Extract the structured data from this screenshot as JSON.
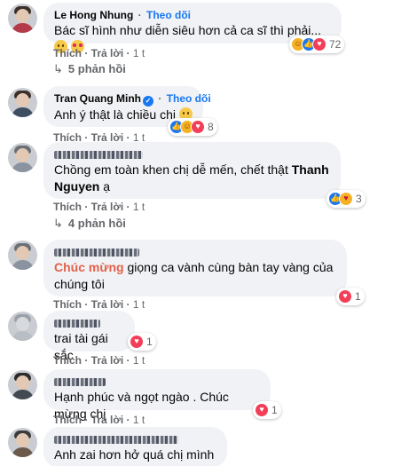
{
  "labels": {
    "like": "Thích",
    "reply": "Trả lời",
    "follow": "Theo dõi"
  },
  "comments": [
    {
      "name": "Le Hong Nhung",
      "text": "Bác sĩ hình như diễn siêu hơn cả ca sĩ thì phải...",
      "emoji": [
        "grinning-sweat-emoji",
        "heart-eyes-emoji"
      ],
      "reactions": {
        "icons": [
          "haha",
          "like",
          "love"
        ],
        "count": "72"
      },
      "time": "1 t",
      "replies": "5 phản hồi"
    },
    {
      "name": "Tran Quang Minh",
      "text": "Anh ý thật là chiều chị",
      "emoji": [
        "smiling-emoji"
      ],
      "reactions": {
        "icons": [
          "like",
          "haha",
          "love"
        ],
        "count": "8"
      },
      "time": "1 t"
    },
    {
      "name": "",
      "text_a": "Chồng em toàn khen chị dễ mến, chết thật ",
      "mention": "Thanh Nguyen",
      "text_b": " ạ",
      "reactions": {
        "icons": [
          "like",
          "care"
        ],
        "count": "3"
      },
      "time": "1 t",
      "replies": "4 phản hồi"
    },
    {
      "name": "",
      "tag": "Chúc mừng",
      "text": " giọng ca vành cùng bàn tay vàng của chúng tôi",
      "reactions": {
        "icons": [
          "love"
        ],
        "count": "1"
      },
      "time": "1 t"
    },
    {
      "name": "",
      "text": "trai tài gái sắc",
      "reactions": {
        "icons": [
          "love"
        ],
        "count": "1"
      },
      "time": "1 t"
    },
    {
      "name": "",
      "text": "Hạnh phúc và ngọt ngào . Chúc mừng chị",
      "reactions": {
        "icons": [
          "love"
        ],
        "count": "1"
      },
      "time": "1 t"
    },
    {
      "name": "",
      "text": "Anh zai hơn hở quá chị mình ơi!"
    }
  ]
}
